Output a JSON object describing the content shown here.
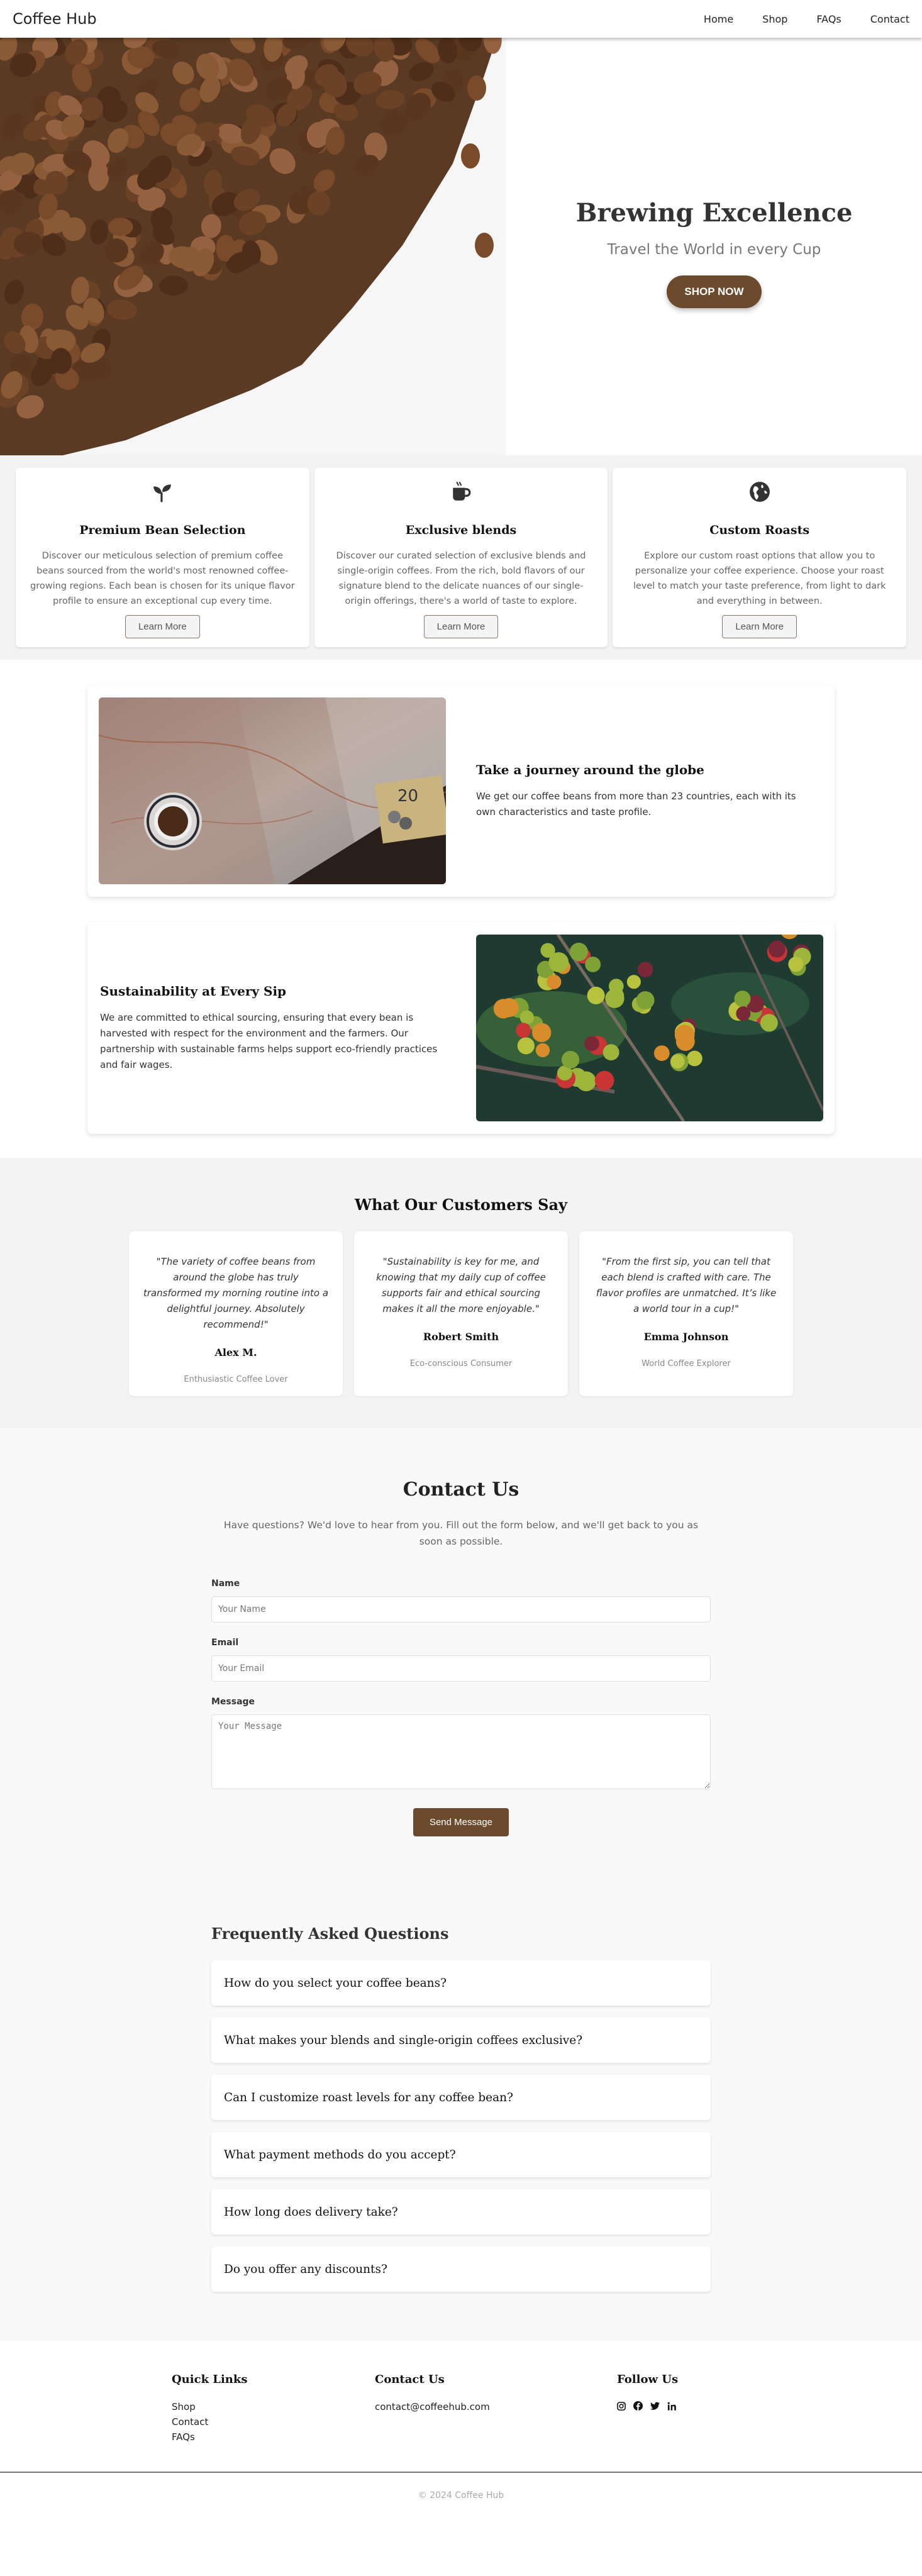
{
  "nav": {
    "brand": "Coffee Hub",
    "links": [
      "Home",
      "Shop",
      "FAQs",
      "Contact"
    ]
  },
  "hero": {
    "image": "coffee-beans-photo",
    "title": "Brewing Excellence",
    "subtitle": "Travel the World in every Cup",
    "cta": "SHOP NOW"
  },
  "features": [
    {
      "icon": "seedling-icon",
      "title": "Premium Bean Selection",
      "text": "Discover our meticulous selection of premium coffee beans sourced from the world's most renowned coffee-growing regions. Each bean is chosen for its unique flavor profile to ensure an exceptional cup every time.",
      "button": "Learn More"
    },
    {
      "icon": "coffee-cup-icon",
      "title": "Exclusive blends",
      "text": "Discover our curated selection of exclusive blends and single-origin coffees. From the rich, bold flavors of our signature blend to the delicate nuances of our single-origin offerings, there's a world of taste to explore.",
      "button": "Learn More"
    },
    {
      "icon": "globe-icon",
      "title": "Custom Roasts",
      "text": "Explore our custom roast options that allow you to personalize your coffee experience. Choose your roast level to match your taste preference, from light to dark and everything in between.",
      "button": "Learn More"
    }
  ],
  "story": [
    {
      "image": "map-and-coffee-cup-photo",
      "title": "Take a journey around the globe",
      "text": "We get our coffee beans from more than 23 countries, each with its own characteristics and taste profile."
    },
    {
      "image": "coffee-cherries-photo",
      "title": "Sustainability at Every Sip",
      "text": "We are committed to ethical sourcing, ensuring that every bean is harvested with respect for the environment and the farmers. Our partnership with sustainable farms helps support eco-friendly practices and fair wages."
    }
  ],
  "testimonials": {
    "title": "What Our Customers Say",
    "items": [
      {
        "quote": "\"The variety of coffee beans from around the globe has truly transformed my morning routine into a delightful journey. Absolutely recommend!\"",
        "name": "Alex M.",
        "role": "Enthusiastic Coffee Lover"
      },
      {
        "quote": "\"Sustainability is key for me, and knowing that my daily cup of coffee supports fair and ethical sourcing makes it all the more enjoyable.\"",
        "name": "Robert Smith",
        "role": "Eco-conscious Consumer"
      },
      {
        "quote": "\"From the first sip, you can tell that each blend is crafted with care. The flavor profiles are unmatched. It’s like a world tour in a cup!\"",
        "name": "Emma Johnson",
        "role": "World Coffee Explorer"
      }
    ]
  },
  "contact": {
    "title": "Contact Us",
    "lead": "Have questions? We'd love to hear from you. Fill out the form below, and we'll get back to you as soon as possible.",
    "name_label": "Name",
    "name_placeholder": "Your Name",
    "name_value": "",
    "email_label": "Email",
    "email_placeholder": "Your Email",
    "email_value": "",
    "message_label": "Message",
    "message_placeholder": "Your Message",
    "message_value": "",
    "submit": "Send Message"
  },
  "faq": {
    "title": "Frequently Asked Questions",
    "items": [
      "How do you select your coffee beans?",
      "What makes your blends and single-origin coffees exclusive?",
      "Can I customize roast levels for any coffee bean?",
      "What payment methods do you accept?",
      "How long does delivery take?",
      "Do you offer any discounts?"
    ]
  },
  "footer": {
    "quick_links_title": "Quick Links",
    "quick_links": [
      "Shop",
      "Contact",
      "FAQs"
    ],
    "contact_title": "Contact Us",
    "email": "contact@coffeehub.com",
    "follow_title": "Follow Us",
    "social": [
      "instagram-icon",
      "facebook-icon",
      "twitter-icon",
      "linkedin-icon"
    ],
    "copyright": "© 2024 Coffee Hub"
  },
  "colors": {
    "accent": "#6b4a2e",
    "section_gray": "#f3f3f3",
    "section_light": "#f9f9f9"
  }
}
